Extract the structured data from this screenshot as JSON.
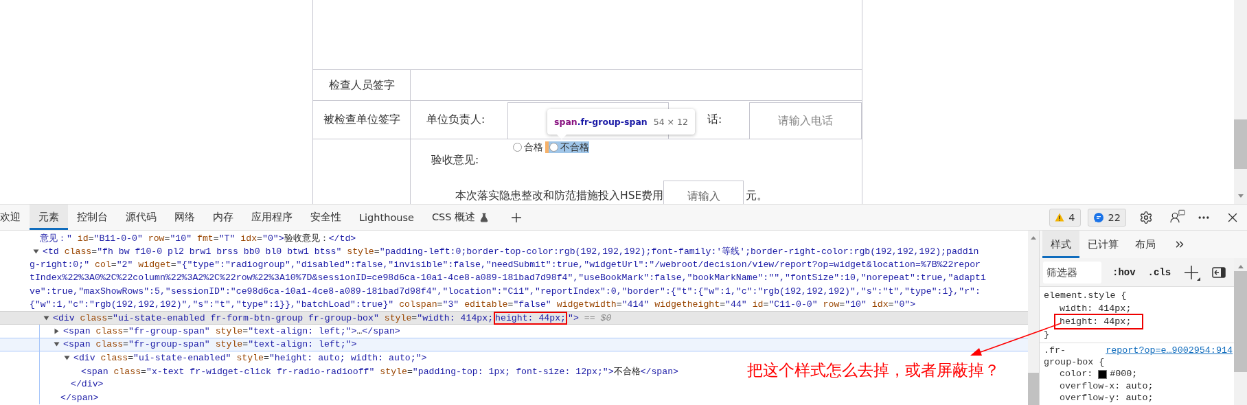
{
  "form": {
    "inspector_label": "检查人员签字",
    "unit_label": "被检查单位签字",
    "responsible_label": "单位负责人:",
    "phone_label": "话:",
    "phone_placeholder": "请输入电话",
    "opinion_label": "验收意见:",
    "radios": [
      {
        "label": "合格",
        "selected": false,
        "highlighted": false
      },
      {
        "label": "不合格",
        "selected": false,
        "highlighted": true
      }
    ],
    "hse_label": "本次落实隐患整改和防范措施投入HSE费用",
    "hse_placeholder": "请输入",
    "hse_unit": "元。"
  },
  "inspect_tooltip": {
    "selector": "span.fr-group-span",
    "size": "54 × 12"
  },
  "devtools": {
    "tabs": [
      {
        "label": "欢迎",
        "selected": false
      },
      {
        "label": "元素",
        "selected": true
      },
      {
        "label": "控制台",
        "selected": false
      },
      {
        "label": "源代码",
        "selected": false
      },
      {
        "label": "网络",
        "selected": false
      },
      {
        "label": "内存",
        "selected": false
      },
      {
        "label": "应用程序",
        "selected": false
      },
      {
        "label": "安全性",
        "selected": false
      },
      {
        "label": "Lighthouse",
        "selected": false
      },
      {
        "label": "CSS 概述",
        "selected": false,
        "experimental": true
      }
    ],
    "badges": [
      {
        "kind": "warning",
        "count": "4"
      },
      {
        "kind": "message",
        "count": "22"
      }
    ]
  },
  "elements": {
    "nodes": [
      {
        "lines": [
          "意见：\" id=\"B11-0-0\" row=\"10\" fmt=\"T\" idx=\"0\">验收意见：</td>"
        ],
        "selected": false,
        "hovered": false
      },
      {
        "lines": [
          "<td class=\"fh bw f10-0 pl2 brw1 brss bb0 bl0 btw1 btss\" style=\"padding-left:0;border-top-color:rgb(192,192,192);font-family:'等线';border-right-color:rgb(192,192,192);paddin",
          "g-right:0;\" col=\"2\" widget=\"{\"type\":\"radiogroup\",\"disabled\":false,\"invisible\":false,\"needSubmit\":true,\"widgetUrl\":\"/webroot/decision/view/report?op=widget&location=%7B%22repor",
          "tIndex%22%3A0%2C%22column%22%3A2%2C%22row%22%3A10%7D&sessionID=ce98d6ca-10a1-4ce8-a089-181bad7d98f4\",\"useBookMark\":false,\"bookMarkName\":\"\",\"fontSize\":10,\"norepeat\":true,\"adapti",
          "ve\":true,\"maxShowRows\":5,\"sessionID\":\"ce98d6ca-10a1-4ce8-a089-181bad7d98f4\",\"location\":\"C11\",\"reportIndex\":0,\"border\":{\"t\":{\"w\":1,\"c\":\"rgb(192,192,192)\",\"s\":\"t\",\"type\":1},\"r\":",
          "{\"w\":1,\"c\":\"rgb(192,192,192)\",\"s\":\"t\",\"type\":1}},\"batchLoad\":true}\" colspan=\"3\" editable=\"false\" widgetwidth=\"414\" widgetheight=\"44\" id=\"C11-0-0\" row=\"10\" idx=\"0\">"
        ],
        "expanded": true,
        "selected": false,
        "hovered": false,
        "children": [
          {
            "lines": [
              "<div class=\"ui-state-enabled fr-form-btn-group fr-group-box\" style=\"width: 414px;"
            ],
            "boxed": "height: 44px;",
            "after": "\">",
            "marker": "== $0",
            "expanded": true,
            "selected": true,
            "hovered": false,
            "children": [
              {
                "lines": [
                  "<span class=\"fr-group-span\" style=\"text-align: left;\">…</span>"
                ],
                "expanded": false,
                "selected": false,
                "hovered": false
              },
              {
                "lines": [
                  "<span class=\"fr-group-span\" style=\"text-align: left;\">"
                ],
                "expanded": true,
                "selected": false,
                "hovered": true,
                "closing": "</span>",
                "children": [
                  {
                    "lines": [
                      "<div class=\"ui-state-enabled\" style=\"height: auto; width: auto;\">"
                    ],
                    "expanded": true,
                    "selected": false,
                    "hovered": false,
                    "closing": "</div>",
                    "children": [
                      {
                        "lines": [
                          "<span class=\"x-text fr-widget-click fr-radio-radiooff\" style=\"padding-top: 1px; font-size: 12px;\">不合格</span>"
                        ],
                        "selected": false,
                        "hovered": false
                      }
                    ]
                  }
                ]
              }
            ]
          }
        ]
      }
    ]
  },
  "styles": {
    "tabs": [
      {
        "label": "样式",
        "selected": true
      },
      {
        "label": "已计算",
        "selected": false
      },
      {
        "label": "布局",
        "selected": false
      }
    ],
    "filter_placeholder": "筛选器",
    "toggles": [
      ":hov",
      ".cls"
    ],
    "rules": [
      {
        "selector_lines": [
          "element.style {"
        ],
        "declarations": [
          {
            "name": "width:",
            "value": "414px;",
            "boxed": false
          },
          {
            "name": "height:",
            "value": "44px;",
            "boxed": true
          }
        ],
        "close": "}"
      },
      {
        "selector_lines": [
          ".fr-",
          "group-box {"
        ],
        "source": "report?op=e…9002954:914",
        "declarations": [
          {
            "name": "color:",
            "value": "#000;",
            "kind": "color",
            "boxed": false
          },
          {
            "name": "overflow-x:",
            "value": "auto;",
            "boxed": false
          },
          {
            "name": "overflow-y:",
            "value": "auto;",
            "boxed": false
          }
        ]
      }
    ]
  },
  "annotation": {
    "text": "把这个样式怎么去掉，或者屏蔽掉？"
  }
}
